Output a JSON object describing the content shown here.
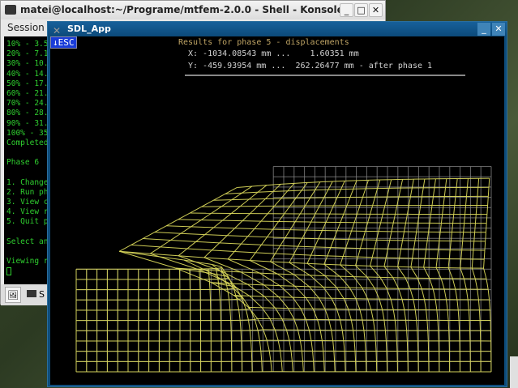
{
  "konsole": {
    "title": "matei@localhost:~/Programe/mtfem-2.0.0 - Shell - Konsole",
    "menu": [
      "Session"
    ],
    "buttons": {
      "minimize": "_",
      "maximize": "□",
      "close": "✕"
    },
    "terminal_lines": [
      "10% - 3.5",
      "20% - 7.1",
      "30% - 10.",
      "40% - 14.",
      "50% - 17.",
      "60% - 21.",
      "70% - 24.",
      "80% - 28.",
      "90% - 31.",
      "100% - 35",
      "Completed",
      "",
      "Phase 6",
      "",
      "1. Change",
      "2. Run ph",
      "3. View c",
      "4. View r",
      "5. Quit p",
      "",
      "Select an",
      "",
      "Viewing r"
    ],
    "taskbar_tab": "S"
  },
  "sdl": {
    "title": "SDL_App",
    "esc_label": "↓ESC",
    "buttons": {
      "minimize": "_",
      "close": "✕"
    },
    "header": "Results for phase 5 - displacements",
    "x_range": "X: -1034.08543 mm ...    1.60351 mm",
    "y_range": "Y: -459.93954 mm ...  262.26477 mm - after phase 1",
    "colors": {
      "original_mesh": "#8c8c8c",
      "deformed_mesh": "#d8d65a",
      "header_text": "#c0a565"
    }
  }
}
